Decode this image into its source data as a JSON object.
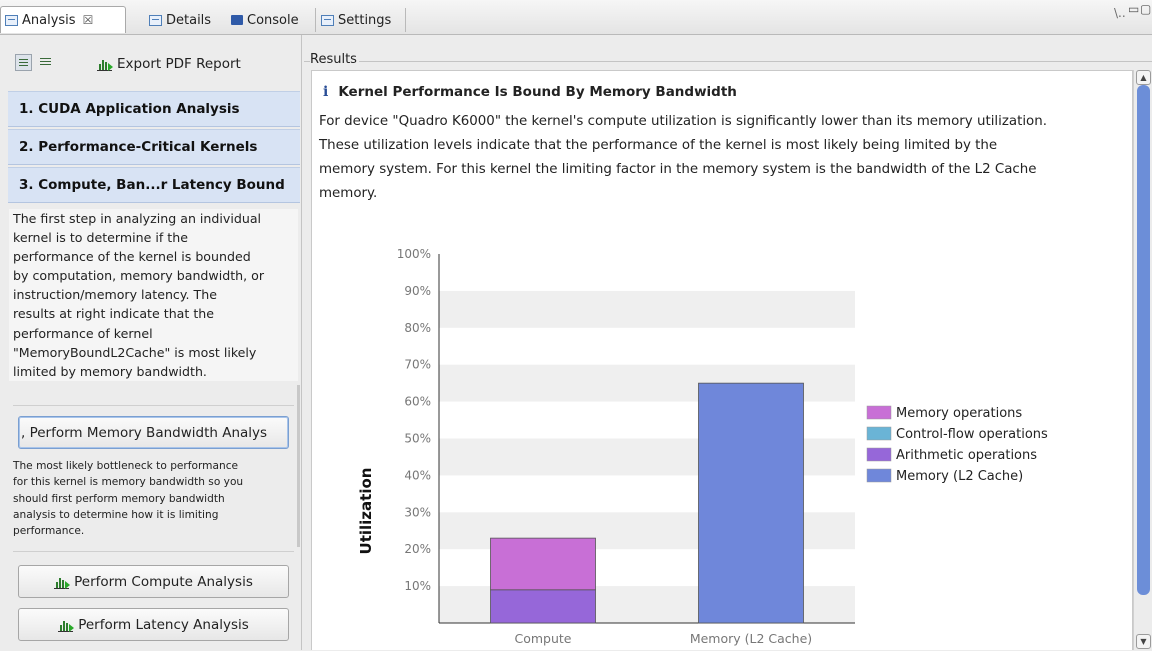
{
  "tabs": [
    {
      "label": "Analysis",
      "active": true,
      "close": "☒"
    },
    {
      "label": "Details"
    },
    {
      "label": "Console"
    },
    {
      "label": "Settings"
    }
  ],
  "toolbar_right": {
    "overflow": "\\..",
    "minimize": "▭",
    "maximize": "▢"
  },
  "left": {
    "export_label": "Export PDF Report",
    "sections": [
      {
        "label": "1. CUDA Application Analysis"
      },
      {
        "label": "2. Performance-Critical Kernels"
      },
      {
        "label": "3. Compute, Ban...r Latency Bound"
      }
    ],
    "description": [
      "The first step in analyzing an individual",
      "kernel is to determine if the",
      "performance of the kernel is bounded",
      "by computation, memory bandwidth, or",
      "instruction/memory latency.  The",
      "results at right indicate that the",
      "performance of kernel",
      "\"MemoryBoundL2Cache\" is most likely",
      "limited by memory bandwidth."
    ],
    "primary_button": ", Perform Memory Bandwidth Analys",
    "primary_note": [
      "The most likely bottleneck to performance",
      "for this kernel is memory bandwidth so you",
      "should first perform memory bandwidth",
      "analysis to determine how it is limiting",
      "performance."
    ],
    "compute_button": "Perform Compute Analysis",
    "latency_button": "Perform Latency Analysis"
  },
  "results": {
    "group_label": "Results",
    "title": "Kernel Performance Is Bound By Memory Bandwidth",
    "info_glyph": "i",
    "body": [
      "For device \"Quadro K6000\" the kernel's compute utilization is significantly lower than its memory utilization.",
      "These utilization levels indicate that the performance of the kernel is most likely being limited by the",
      "memory system. For this kernel the limiting factor in the memory system is the bandwidth of the L2 Cache",
      "memory."
    ]
  },
  "colors": {
    "memory_operations": "#c86fd6",
    "control_flow_operations": "#6ab4d6",
    "arithmetic_operations": "#9667d9",
    "memory_l2": "#6f87da"
  },
  "chart_data": {
    "type": "bar",
    "stacked": true,
    "ylabel": "Utilization",
    "xlabel": "",
    "ylim": [
      0,
      100
    ],
    "yticks": [
      "10%",
      "20%",
      "30%",
      "40%",
      "50%",
      "60%",
      "70%",
      "80%",
      "90%",
      "100%"
    ],
    "categories": [
      "Compute",
      "Memory (L2 Cache)"
    ],
    "series": [
      {
        "name": "Memory operations",
        "color": "#c86fd6",
        "values": [
          14,
          0
        ]
      },
      {
        "name": "Control-flow operations",
        "color": "#6ab4d6",
        "values": [
          0,
          0
        ]
      },
      {
        "name": "Arithmetic operations",
        "color": "#9667d9",
        "values": [
          9,
          0
        ]
      },
      {
        "name": "Memory (L2 Cache)",
        "color": "#6f87da",
        "values": [
          0,
          65
        ]
      }
    ],
    "legend_position": "right",
    "grid": "alternating bands"
  }
}
